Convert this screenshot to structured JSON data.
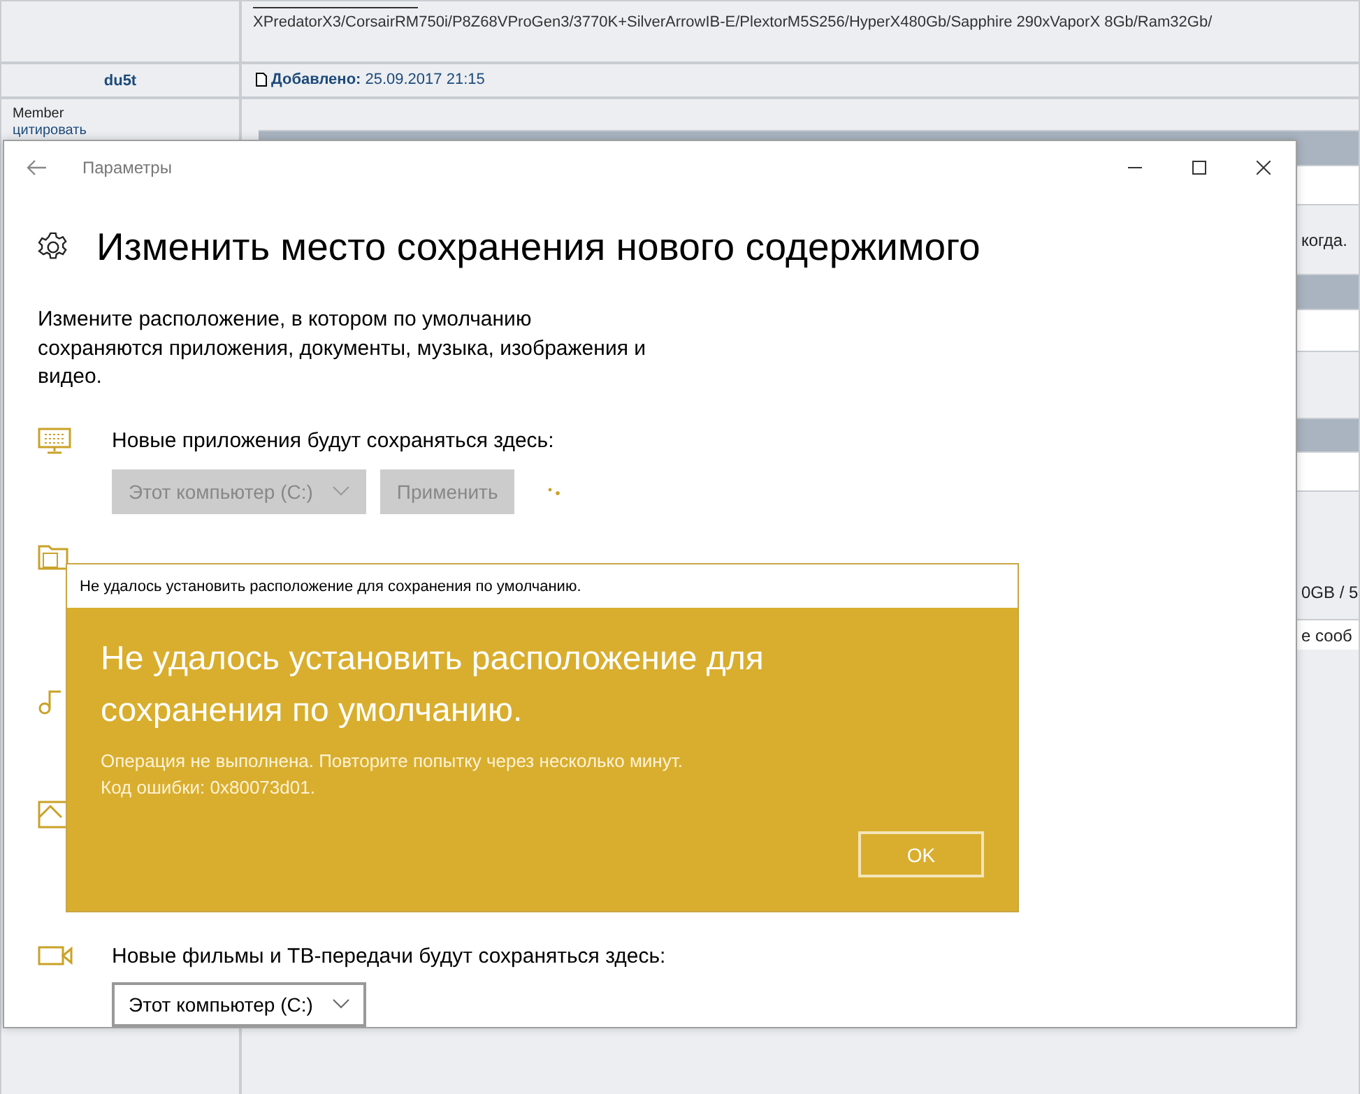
{
  "forum": {
    "signature": "XPredatorX3/CorsairRM750i/P8Z68VProGen3/3770K+SilverArrowIB-E/PlextorM5S256/HyperX480Gb/Sapphire 290xVaporX 8Gb/Ram32Gb/",
    "author": "du5t",
    "added_label": "Добавлено:",
    "added_date": "25.09.2017 21:15",
    "rank": "Member",
    "quote_link": "цитировать",
    "fragments": [
      "когда.",
      "0GB / 5",
      "е сооб"
    ]
  },
  "settings": {
    "window_title": "Параметры",
    "heading": "Изменить место сохранения нового содержимого",
    "description": "Измените расположение, в котором по умолчанию сохраняются приложения, документы, музыка, изображения и видео.",
    "sections": [
      {
        "kind": "apps",
        "label": "Новые приложения будут сохраняться здесь:",
        "dropdown": {
          "value": "Этот компьютер (C:)",
          "disabled": true
        },
        "apply": {
          "label": "Применить",
          "disabled": true
        },
        "busy": true
      },
      {
        "kind": "documents"
      },
      {
        "kind": "music"
      },
      {
        "kind": "pictures"
      },
      {
        "kind": "movies",
        "label": "Новые фильмы и ТВ-передачи будут сохраняться здесь:",
        "dropdown": {
          "value": "Этот компьютер (C:)",
          "disabled": false
        },
        "busy": false
      }
    ]
  },
  "dialog": {
    "title": "Не удалось установить расположение для сохранения по умолчанию.",
    "heading": "Не удалось установить расположение для сохранения по умолчанию.",
    "message": "Операция не выполнена. Повторите попытку через несколько минут.",
    "code": "Код ошибки: 0x80073d01.",
    "button": "OK"
  }
}
